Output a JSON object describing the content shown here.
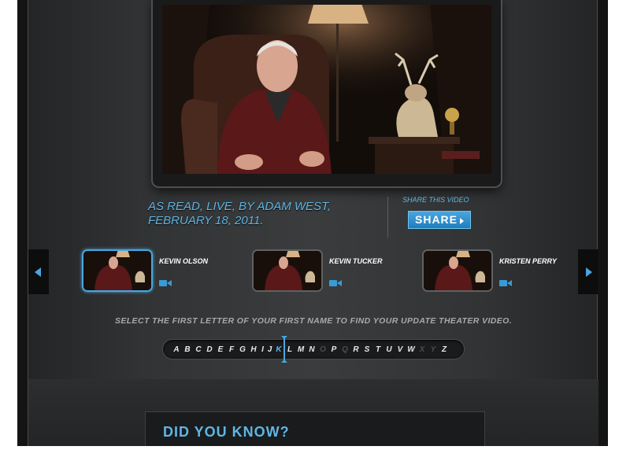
{
  "video": {
    "caption": "As read, live, by Adam West, February 18, 2011."
  },
  "share": {
    "label": "Share this video",
    "button_label": "SHARE"
  },
  "carousel": {
    "items": [
      {
        "name": "KEVIN OLSON",
        "selected": true
      },
      {
        "name": "KEVIN TUCKER",
        "selected": false
      },
      {
        "name": "KRISTEN PERRY",
        "selected": false
      }
    ]
  },
  "alphabet": {
    "instruction": "SELECT THE FIRST LETTER OF YOUR FIRST NAME TO FIND YOUR UPDATE THEATER VIDEO.",
    "letters": [
      "A",
      "B",
      "C",
      "D",
      "E",
      "F",
      "G",
      "H",
      "I",
      "J",
      "K",
      "L",
      "M",
      "N",
      "O",
      "P",
      "Q",
      "R",
      "S",
      "T",
      "U",
      "V",
      "W",
      "X",
      "Y",
      "Z"
    ],
    "disabled": [
      "O",
      "Q",
      "X",
      "Y"
    ],
    "selected": "K"
  },
  "did_you_know": {
    "title": "DID YOU KNOW?"
  },
  "colors": {
    "accent": "#4aa6df",
    "caption_text": "#5fb6e6",
    "panel": "#3a3c3d"
  }
}
